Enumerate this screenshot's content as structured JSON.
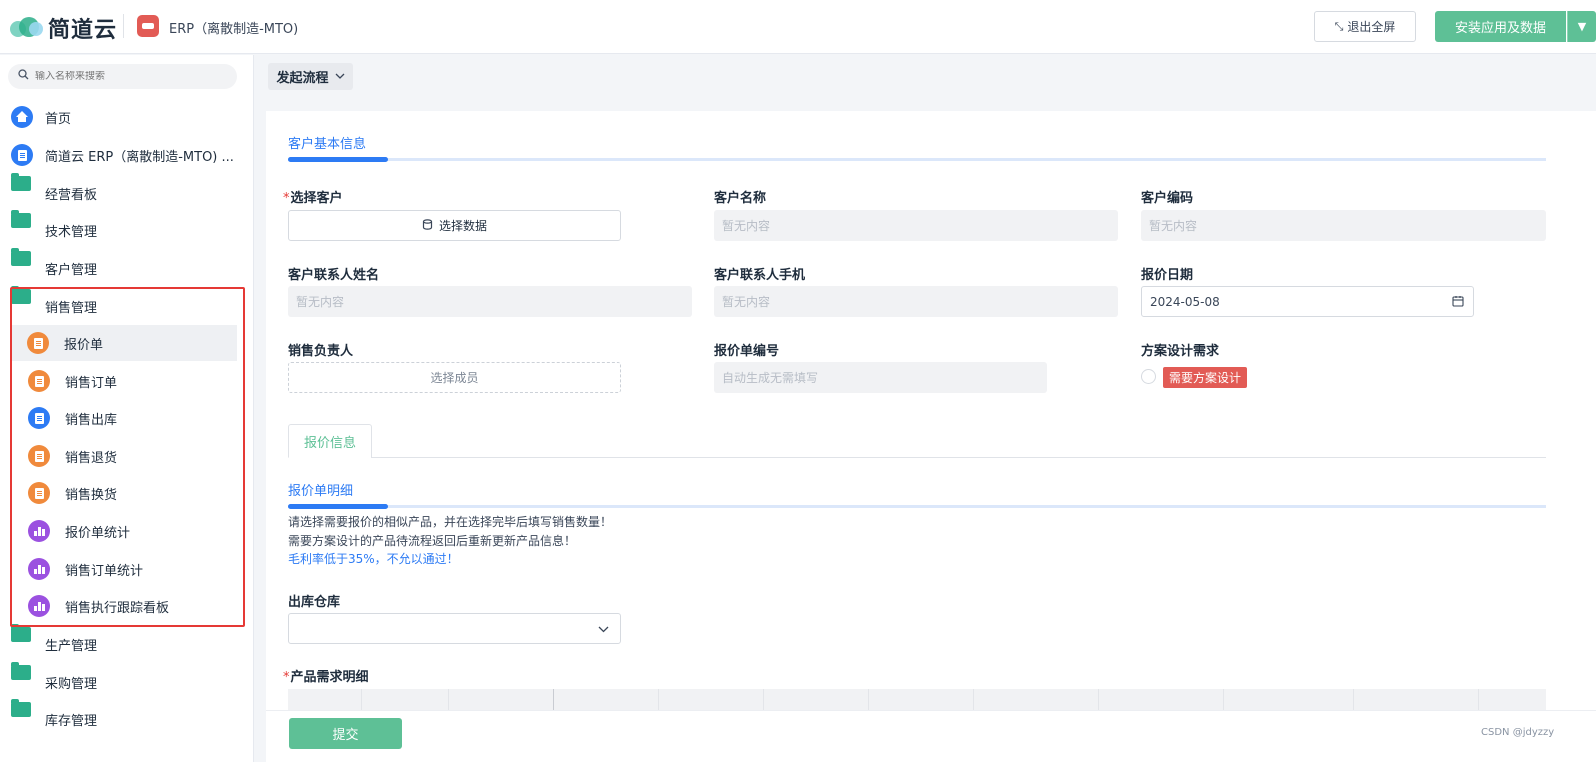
{
  "header": {
    "logo_text": "简道云",
    "app_title": "ERP（离散制造-MTO)",
    "exit_fullscreen_label": "退出全屏",
    "install_label": "安装应用及数据"
  },
  "sidebar": {
    "search_placeholder": "输入名称来搜索",
    "items": [
      {
        "label": "首页",
        "icon": "home-icon"
      },
      {
        "label": "简道云 ERP（离散制造-MTO) ...",
        "icon": "document-icon"
      },
      {
        "label": "经营看板",
        "icon": "folder-icon"
      },
      {
        "label": "技术管理",
        "icon": "folder-icon"
      },
      {
        "label": "客户管理",
        "icon": "folder-icon"
      },
      {
        "label": "销售管理",
        "icon": "folder-open-icon"
      },
      {
        "label": "报价单",
        "icon": "form-icon",
        "active": true
      },
      {
        "label": "销售订单",
        "icon": "form-icon"
      },
      {
        "label": "销售出库",
        "icon": "form-icon"
      },
      {
        "label": "销售退货",
        "icon": "form-icon"
      },
      {
        "label": "销售换货",
        "icon": "form-icon"
      },
      {
        "label": "报价单统计",
        "icon": "chart-icon"
      },
      {
        "label": "销售订单统计",
        "icon": "chart-icon"
      },
      {
        "label": "销售执行跟踪看板",
        "icon": "chart-icon"
      },
      {
        "label": "生产管理",
        "icon": "folder-icon"
      },
      {
        "label": "采购管理",
        "icon": "folder-icon"
      },
      {
        "label": "库存管理",
        "icon": "folder-icon"
      }
    ]
  },
  "toolbar": {
    "start_flow_label": "发起流程"
  },
  "form": {
    "section_basic": "客户基本信息",
    "select_customer_label": "选择客户",
    "select_data_button": "选择数据",
    "customer_name_label": "客户名称",
    "customer_name_value": "暂无内容",
    "customer_code_label": "客户编码",
    "customer_code_value": "暂无内容",
    "contact_name_label": "客户联系人姓名",
    "contact_name_value": "暂无内容",
    "contact_phone_label": "客户联系人手机",
    "contact_phone_value": "暂无内容",
    "quote_date_label": "报价日期",
    "quote_date_value": "2024-05-08",
    "sales_owner_label": "销售负责人",
    "select_member_placeholder": "选择成员",
    "quote_no_label": "报价单编号",
    "quote_no_placeholder": "自动生成无需填写",
    "design_need_label": "方案设计需求",
    "design_need_option": "需要方案设计",
    "tab_label": "报价信息",
    "section_detail": "报价单明细",
    "note_1": "请选择需要报价的相似产品，并在选择完毕后填写销售数量！",
    "note_2": "需要方案设计的产品待流程返回后重新更新产品信息！",
    "note_3": "毛利率低于35%，不允以通过！",
    "warehouse_label": "出库仓库",
    "product_detail_label": "产品需求明细",
    "submit_label": "提交"
  },
  "watermark": "CSDN @jdyzzy",
  "colors": {
    "accent_green": "#5ec096",
    "accent_blue": "#2d7bf4",
    "alert_red": "#e25b55",
    "highlight_border": "#e53935"
  }
}
